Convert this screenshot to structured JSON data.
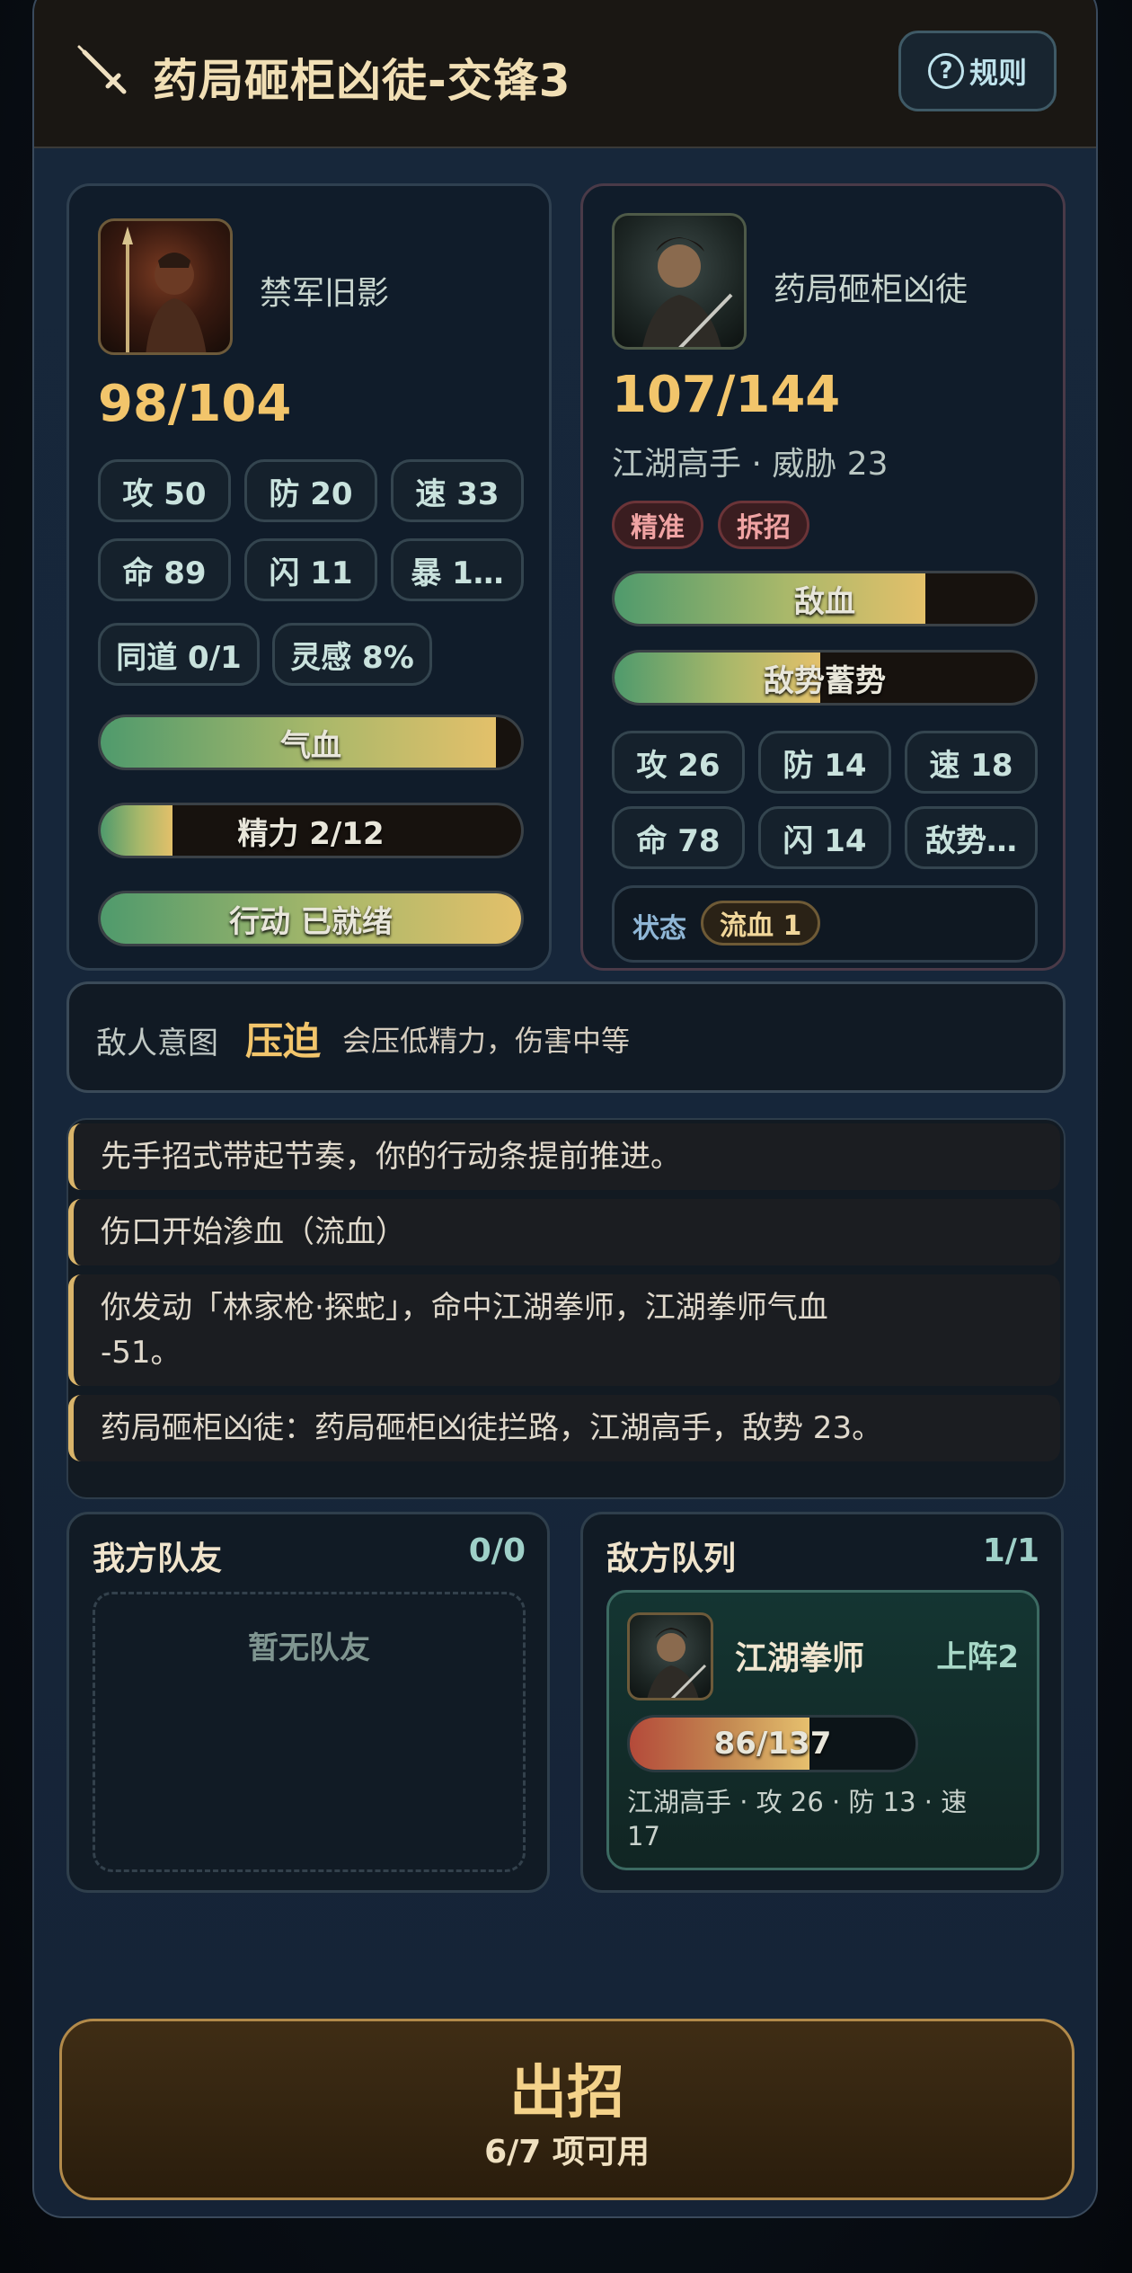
{
  "header": {
    "title": "药局砸柜凶徒-交锋3",
    "rules_label": "规则"
  },
  "player": {
    "name": "禁军旧影",
    "hp": "98/104",
    "hp_ratio": 0.94,
    "stats": [
      "攻 50",
      "防 20",
      "速 33",
      "命 89",
      "闪 11",
      "暴 1…"
    ],
    "extras": [
      "同道 0/1",
      "灵感 8%"
    ],
    "bars": [
      {
        "label": "气血",
        "ratio": 0.94
      },
      {
        "label": "精力 2/12",
        "ratio": 0.17
      },
      {
        "label": "行动 已就绪",
        "ratio": 1.0
      }
    ]
  },
  "enemy": {
    "name": "药局砸柜凶徒",
    "hp": "107/144",
    "subtitle": "江湖高手 · 威胁 23",
    "tags": [
      "精准",
      "拆招"
    ],
    "bars": [
      {
        "label": "敌血",
        "ratio": 0.74
      },
      {
        "label": "敌势蓄势",
        "ratio": 0.49
      }
    ],
    "stats": [
      "攻 26",
      "防 14",
      "速 18",
      "命 78",
      "闪 14",
      "敌势…"
    ],
    "status_label": "状态",
    "status_effect": "流血 1"
  },
  "intent": {
    "label": "敌人意图",
    "value": "压迫",
    "desc": "会压低精力，伤害中等"
  },
  "log": [
    "先手招式带起节奏，你的行动条提前推进。",
    "伤口开始渗血（流血）",
    "你发动「林家枪·探蛇」，命中江湖拳师，江湖拳师气血\n-51。",
    "药局砸柜凶徒：药局砸柜凶徒拦路，江湖高手，敌势 23。"
  ],
  "allies": {
    "title": "我方队友",
    "count": "0/0",
    "empty_text": "暂无队友"
  },
  "enemy_queue": {
    "title": "敌方队列",
    "count": "1/1",
    "items": [
      {
        "name": "江湖拳师",
        "badge": "上阵2",
        "hp": "86/137",
        "hp_ratio": 0.63,
        "info": "江湖高手 · 攻 26 · 防 13 · 速\n17"
      }
    ]
  },
  "action": {
    "title": "出招",
    "subtitle": "6/7 项可用"
  },
  "colors": {
    "accent_gold": "#f2c56b",
    "hp_green": "#4f9a6c",
    "danger_red": "#f0a3a3"
  },
  "icons": {
    "title": "sword-icon",
    "rules": "question-circle-icon",
    "player_avatar": "warrior-portrait-icon",
    "enemy_avatar": "swordsman-portrait-icon"
  }
}
